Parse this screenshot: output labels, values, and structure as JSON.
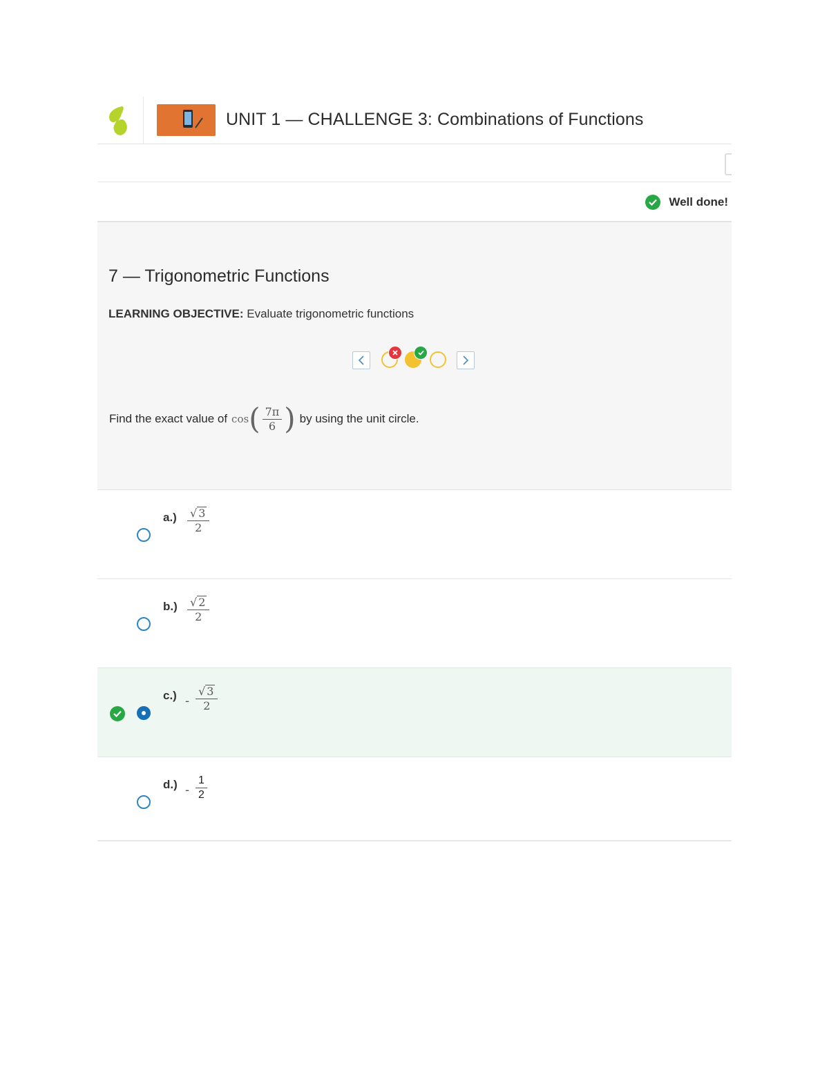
{
  "header": {
    "unit_title": "UNIT 1 — CHALLENGE 3: Combinations of Functions"
  },
  "status": {
    "text": "Well done!"
  },
  "question": {
    "title": "7 — Trigonometric Functions",
    "objective_label": "LEARNING OBJECTIVE:",
    "objective_text": "Evaluate trigonometric functions",
    "prompt_before": "Find the exact value of",
    "cos": "cos",
    "arg_num": "7π",
    "arg_den": "6",
    "prompt_after": "by using the unit circle."
  },
  "pager": {
    "attempts": [
      {
        "state": "incorrect"
      },
      {
        "state": "correct",
        "current": true
      },
      {
        "state": "unanswered"
      }
    ]
  },
  "answers": [
    {
      "letter": "a.)",
      "sign": "",
      "radicand": "3",
      "numerator": "",
      "denominator": "2",
      "selected": false
    },
    {
      "letter": "b.)",
      "sign": "",
      "radicand": "2",
      "numerator": "",
      "denominator": "2",
      "selected": false
    },
    {
      "letter": "c.)",
      "sign": "-",
      "radicand": "3",
      "numerator": "",
      "denominator": "2",
      "selected": true,
      "correct": true
    },
    {
      "letter": "d.)",
      "sign": "-",
      "radicand": "",
      "numerator": "1",
      "denominator": "2",
      "selected": false
    }
  ],
  "colors": {
    "accent_orange": "#e07430",
    "success_green": "#28a745",
    "error_red": "#e5353e",
    "attempt_yellow": "#f2c230",
    "radio_blue": "#1770b6"
  }
}
